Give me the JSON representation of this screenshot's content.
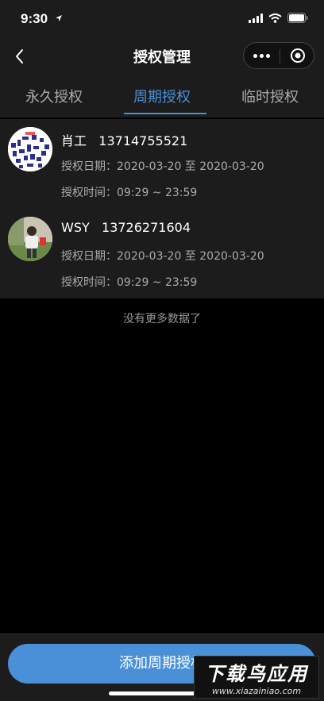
{
  "status_bar": {
    "time": "9:30"
  },
  "nav": {
    "title": "授权管理"
  },
  "tabs": [
    {
      "label": "永久授权",
      "active": false
    },
    {
      "label": "周期授权",
      "active": true
    },
    {
      "label": "临时授权",
      "active": false
    }
  ],
  "records": [
    {
      "name": "肖工",
      "phone": "13714755521",
      "date_line": "授权日期：2020-03-20 至 2020-03-20",
      "time_line": "授权时间：09:29 ~ 23:59"
    },
    {
      "name": "WSY",
      "phone": "13726271604",
      "date_line": "授权日期：2020-03-20 至 2020-03-20",
      "time_line": "授权时间：09:29 ~ 23:59"
    }
  ],
  "list_footer": "没有更多数据了",
  "add_button_label": "添加周期授权",
  "watermark": {
    "main": "下载鸟应用",
    "sub": "www.xiazainiao.com"
  },
  "colors": {
    "accent": "#4a90d9",
    "panel": "#1c1c1c",
    "background": "#000000"
  }
}
